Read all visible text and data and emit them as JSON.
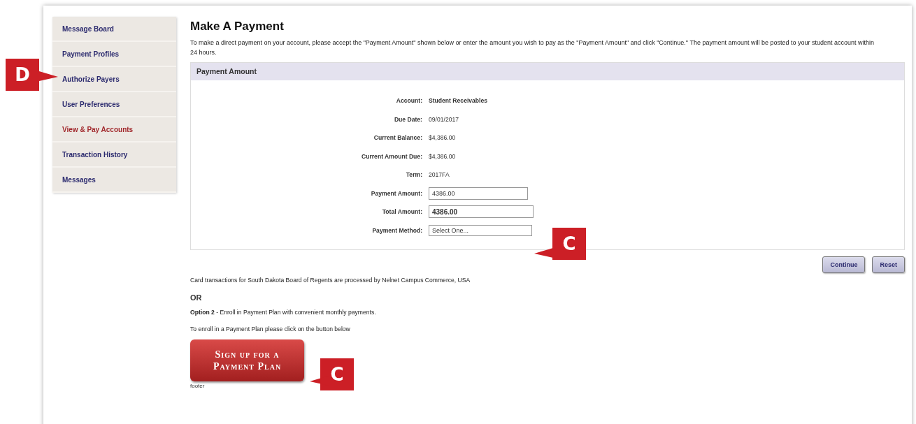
{
  "sidebar": {
    "items": [
      {
        "label": "Message Board",
        "selected": false
      },
      {
        "label": "Payment Profiles",
        "selected": false
      },
      {
        "label": "Authorize Payers",
        "selected": false
      },
      {
        "label": "User Preferences",
        "selected": false
      },
      {
        "label": "View & Pay Accounts",
        "selected": true
      },
      {
        "label": "Transaction History",
        "selected": false
      },
      {
        "label": "Messages",
        "selected": false
      }
    ]
  },
  "title": "Make A Payment",
  "intro": "To make a direct payment on your account, please accept the \"Payment Amount\" shown below or enter the amount you wish to pay as the \"Payment Amount\" and click \"Continue.\" The payment amount will be posted to your student account within 24 hours.",
  "panel": {
    "header": "Payment Amount",
    "rows": [
      {
        "kind": "text",
        "label": "Account:",
        "value": "Student Receivables",
        "bold": true
      },
      {
        "kind": "text",
        "label": "Due Date:",
        "value": "09/01/2017",
        "bold": false
      },
      {
        "kind": "text",
        "label": "Current Balance:",
        "value": "$4,386.00",
        "bold": false
      },
      {
        "kind": "text",
        "label": "Current Amount Due:",
        "value": "$4,386.00",
        "bold": false
      },
      {
        "kind": "text",
        "label": "Term:",
        "value": "2017FA",
        "bold": false
      },
      {
        "kind": "input",
        "label": "Payment Amount:",
        "value": "4386.00",
        "bold": false
      },
      {
        "kind": "input",
        "label": "Total Amount:",
        "value": "4386.00",
        "bold": true
      },
      {
        "kind": "select",
        "label": "Payment Method:",
        "value": "Select One...",
        "bold": false
      }
    ]
  },
  "buttons": [
    "Continue",
    "Reset"
  ],
  "card_note": "Card transactions for South Dakota Board of Regents are processed by Nelnet Campus Commerce, USA",
  "or": "OR",
  "option2": "**Option 2** - Enroll in Payment Plan with convenient monthly payments.",
  "enroll_note": "To enroll in a Payment Plan please click on the button below",
  "plan_button": "Sign up for a Payment Plan",
  "footer": "footer",
  "callouts": [
    {
      "letter": "D"
    },
    {
      "letter": "C"
    },
    {
      "letter": "C"
    }
  ]
}
